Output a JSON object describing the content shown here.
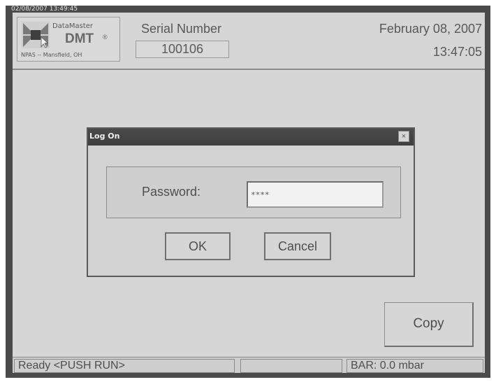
{
  "stamp": "02/08/2007 13:49:45",
  "header": {
    "logo_brand": "DataMaster",
    "logo_product": "DMT",
    "logo_registered": "®",
    "logo_subtitle": "NPAS -- Mansfield, OH",
    "serial_label": "Serial Number",
    "serial_value": "100106",
    "date": "February 08, 2007",
    "time": "13:47:05"
  },
  "dialog": {
    "title": "Log On",
    "close_glyph": "×",
    "password_label": "Password:",
    "password_value": "****",
    "ok_label": "OK",
    "cancel_label": "Cancel"
  },
  "copy_button": "Copy",
  "statusbar": {
    "ready_text": "Ready   <PUSH RUN>",
    "middle_text": "",
    "barometer_text": "BAR: 0.0 mbar"
  },
  "colors": {
    "bezel": "#4b4b4b",
    "background": "#d6d6d6",
    "titlebar": "#444444"
  }
}
